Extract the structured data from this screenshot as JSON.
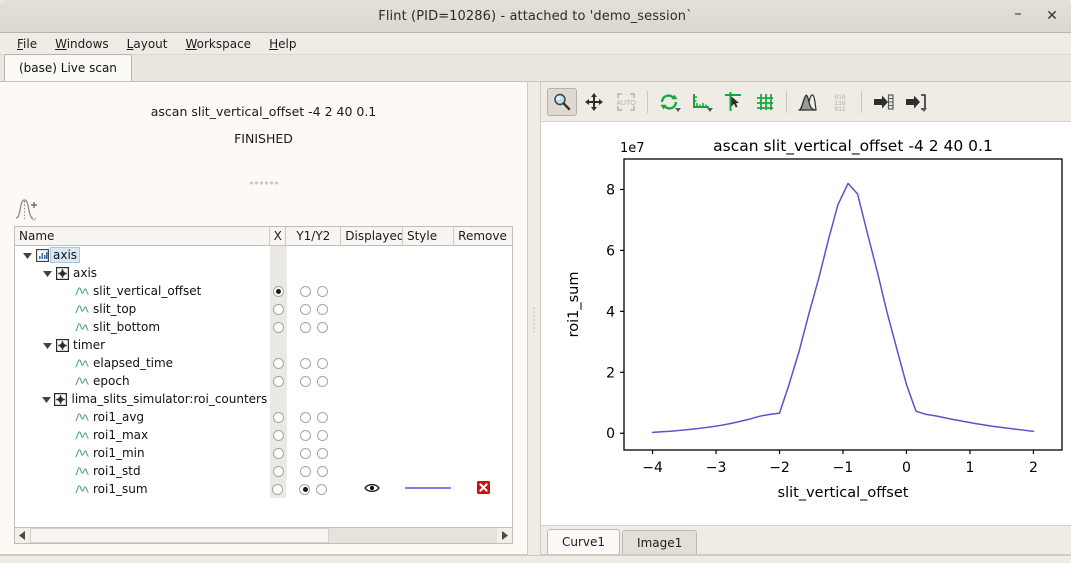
{
  "window": {
    "title": "Flint (PID=10286) - attached to 'demo_session`",
    "minimize_label": "–",
    "close_label": "✕"
  },
  "menubar": {
    "items": [
      {
        "label": "File",
        "accel": "F"
      },
      {
        "label": "Windows",
        "accel": "W"
      },
      {
        "label": "Layout",
        "accel": "L"
      },
      {
        "label": "Workspace",
        "accel": "W"
      },
      {
        "label": "Help",
        "accel": "H"
      }
    ]
  },
  "tabs": {
    "items": [
      {
        "label": "(base) Live scan",
        "active": true
      }
    ]
  },
  "left_panel": {
    "scan_title": "ascan slit_vertical_offset -4 2 40 0.1",
    "scan_status": "FINISHED",
    "add_curve_icon": "add-curve-icon",
    "table": {
      "columns": [
        "Name",
        "X",
        "Y1/Y2",
        "Displayed",
        "Style",
        "Remove"
      ],
      "rows": [
        {
          "label": "axis",
          "depth": 0,
          "icon": "chart-icon",
          "expandable": true,
          "expanded": true,
          "selected": true,
          "has_controls": false
        },
        {
          "label": "axis",
          "depth": 1,
          "icon": "device-icon",
          "expandable": true,
          "expanded": true,
          "selected": false,
          "has_controls": false
        },
        {
          "label": "slit_vertical_offset",
          "depth": 2,
          "icon": "curve-icon",
          "expandable": false,
          "expanded": false,
          "selected": false,
          "has_controls": true,
          "x": true,
          "y1": false,
          "y2": false,
          "displayed": false,
          "style": false,
          "remove": false
        },
        {
          "label": "slit_top",
          "depth": 2,
          "icon": "curve-icon",
          "expandable": false,
          "expanded": false,
          "selected": false,
          "has_controls": true,
          "x": false,
          "y1": false,
          "y2": false,
          "displayed": false,
          "style": false,
          "remove": false
        },
        {
          "label": "slit_bottom",
          "depth": 2,
          "icon": "curve-icon",
          "expandable": false,
          "expanded": false,
          "selected": false,
          "has_controls": true,
          "x": false,
          "y1": false,
          "y2": false,
          "displayed": false,
          "style": false,
          "remove": false
        },
        {
          "label": "timer",
          "depth": 1,
          "icon": "device-icon",
          "expandable": true,
          "expanded": true,
          "selected": false,
          "has_controls": false
        },
        {
          "label": "elapsed_time",
          "depth": 2,
          "icon": "curve-icon",
          "expandable": false,
          "expanded": false,
          "selected": false,
          "has_controls": true,
          "x": false,
          "y1": false,
          "y2": false,
          "displayed": false,
          "style": false,
          "remove": false
        },
        {
          "label": "epoch",
          "depth": 2,
          "icon": "curve-icon",
          "expandable": false,
          "expanded": false,
          "selected": false,
          "has_controls": true,
          "x": false,
          "y1": false,
          "y2": false,
          "displayed": false,
          "style": false,
          "remove": false
        },
        {
          "label": "lima_slits_simulator:roi_counters",
          "depth": 1,
          "icon": "device-icon",
          "expandable": true,
          "expanded": true,
          "selected": false,
          "has_controls": false
        },
        {
          "label": "roi1_avg",
          "depth": 2,
          "icon": "curve-icon",
          "expandable": false,
          "expanded": false,
          "selected": false,
          "has_controls": true,
          "x": false,
          "y1": false,
          "y2": false,
          "displayed": false,
          "style": false,
          "remove": false
        },
        {
          "label": "roi1_max",
          "depth": 2,
          "icon": "curve-icon",
          "expandable": false,
          "expanded": false,
          "selected": false,
          "has_controls": true,
          "x": false,
          "y1": false,
          "y2": false,
          "displayed": false,
          "style": false,
          "remove": false
        },
        {
          "label": "roi1_min",
          "depth": 2,
          "icon": "curve-icon",
          "expandable": false,
          "expanded": false,
          "selected": false,
          "has_controls": true,
          "x": false,
          "y1": false,
          "y2": false,
          "displayed": false,
          "style": false,
          "remove": false
        },
        {
          "label": "roi1_std",
          "depth": 2,
          "icon": "curve-icon",
          "expandable": false,
          "expanded": false,
          "selected": false,
          "has_controls": true,
          "x": false,
          "y1": false,
          "y2": false,
          "displayed": false,
          "style": false,
          "remove": false
        },
        {
          "label": "roi1_sum",
          "depth": 2,
          "icon": "curve-icon",
          "expandable": false,
          "expanded": false,
          "selected": false,
          "has_controls": true,
          "x": false,
          "y1": true,
          "y2": false,
          "displayed": true,
          "style": true,
          "remove": true
        }
      ]
    }
  },
  "plot_toolbar": {
    "buttons": [
      {
        "name": "zoom-tool",
        "icon": "magnifier-icon",
        "active": true
      },
      {
        "name": "pan-tool",
        "icon": "move-arrows-icon",
        "active": false
      },
      {
        "name": "auto-scale",
        "icon": "auto-scale-icon",
        "active": false,
        "disabled": true
      },
      {
        "name": "reset-zoom",
        "icon": "refresh-icon",
        "active": false,
        "menu": true
      },
      {
        "name": "axis-scale",
        "icon": "axis-scale-icon",
        "active": false,
        "menu": true
      },
      {
        "name": "marker-tool",
        "icon": "crosshair-cursor-icon",
        "active": false
      },
      {
        "name": "grid-toggle",
        "icon": "grid-icon",
        "active": false
      },
      {
        "name": "curve-style",
        "icon": "peak-curve-icon",
        "active": false
      },
      {
        "name": "raw-data",
        "icon": "binary-data-icon",
        "active": false,
        "disabled": true
      },
      {
        "name": "export-data",
        "icon": "export-table-icon",
        "active": false
      },
      {
        "name": "export-plot",
        "icon": "export-plot-icon",
        "active": false,
        "menu": true
      }
    ]
  },
  "plot": {
    "accent_color": "#5b51cf",
    "axis_color": "#000000",
    "background": "#ffffff"
  },
  "bottom_tabs": {
    "items": [
      {
        "label": "Curve1",
        "active": true
      },
      {
        "label": "Image1",
        "active": false
      }
    ]
  },
  "chart_data": {
    "type": "line",
    "title": "ascan slit_vertical_offset -4 2 40 0.1",
    "xlabel": "slit_vertical_offset",
    "ylabel": "roi1_sum",
    "y_offset_text": "1e7",
    "y_scale": 10000000,
    "xlim": [
      -4.45,
      2.45
    ],
    "ylim": [
      -0.55,
      9.0
    ],
    "xticks": [
      -4,
      -3,
      -2,
      -1,
      0,
      1,
      2
    ],
    "xticklabels": [
      "−4",
      "−3",
      "−2",
      "−1",
      "0",
      "1",
      "2"
    ],
    "yticks": [
      0,
      2,
      4,
      6,
      8
    ],
    "yticklabels": [
      "0",
      "2",
      "4",
      "6",
      "8"
    ],
    "grid": false,
    "legend": null,
    "series": [
      {
        "name": "roi1_sum",
        "color": "#5b51cf",
        "x": [
          -4.0,
          -3.85,
          -3.69,
          -3.54,
          -3.38,
          -3.23,
          -3.08,
          -2.92,
          -2.77,
          -2.62,
          -2.46,
          -2.31,
          -2.15,
          -2.0,
          -1.85,
          -1.69,
          -1.54,
          -1.38,
          -1.23,
          -1.08,
          -0.92,
          -0.77,
          -0.62,
          -0.46,
          -0.31,
          -0.15,
          0.0,
          0.15,
          0.31,
          0.46,
          0.62,
          0.77,
          0.92,
          1.08,
          1.23,
          1.38,
          1.54,
          1.69,
          1.85,
          2.0
        ],
        "y": [
          0.03,
          0.05,
          0.07,
          0.1,
          0.13,
          0.17,
          0.21,
          0.26,
          0.32,
          0.39,
          0.47,
          0.56,
          0.62,
          0.66,
          1.6,
          2.7,
          3.9,
          5.1,
          6.35,
          7.5,
          8.2,
          7.85,
          6.6,
          5.3,
          4.0,
          2.75,
          1.6,
          0.72,
          0.62,
          0.57,
          0.5,
          0.44,
          0.38,
          0.32,
          0.27,
          0.22,
          0.18,
          0.14,
          0.1,
          0.06
        ]
      }
    ]
  }
}
